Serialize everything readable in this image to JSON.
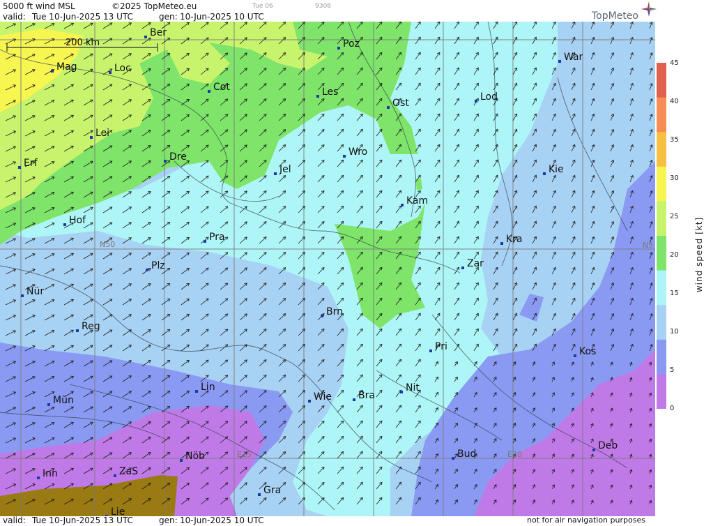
{
  "header": {
    "product": "5000 ft wind MSL",
    "copyright": "©2025 TopMeteo.eu",
    "valid_label": "valid:",
    "valid_value": "Tue  10-Jun-2025  13 UTC",
    "gen_label": "gen:",
    "gen_value": "10-Jun-2025 10 UTC",
    "day_code": "Tue 06",
    "run_code": "9308"
  },
  "footer": {
    "valid_label": "valid:",
    "valid_value": "Tue  10-Jun-2025  13 UTC",
    "gen_label": "gen:",
    "gen_value": "10-Jun-2025 10 UTC",
    "disclaimer": "not for air navigation purposes"
  },
  "logo": {
    "text": "TopMeteo"
  },
  "scale_bar": {
    "label": "200 km"
  },
  "grid_labels": {
    "n50": "N50",
    "e15": "E15",
    "e20": "E20",
    "n5_right": "N5"
  },
  "cities": [
    {
      "name": "Ber"
    },
    {
      "name": "Poz"
    },
    {
      "name": "War"
    },
    {
      "name": "Mag"
    },
    {
      "name": "Loc"
    },
    {
      "name": "Cot"
    },
    {
      "name": "Les"
    },
    {
      "name": "Lod"
    },
    {
      "name": "Ost"
    },
    {
      "name": "Lei"
    },
    {
      "name": "Dre"
    },
    {
      "name": "Wro"
    },
    {
      "name": "Erf"
    },
    {
      "name": "Jel"
    },
    {
      "name": "Kie"
    },
    {
      "name": "Kam"
    },
    {
      "name": "Hof"
    },
    {
      "name": "Kra"
    },
    {
      "name": "Pra"
    },
    {
      "name": "Zar"
    },
    {
      "name": "Plz"
    },
    {
      "name": "Nür"
    },
    {
      "name": "Brn"
    },
    {
      "name": "Reg"
    },
    {
      "name": "Pri"
    },
    {
      "name": "Kos"
    },
    {
      "name": "Lin"
    },
    {
      "name": "Nit"
    },
    {
      "name": "Wie"
    },
    {
      "name": "Bra"
    },
    {
      "name": "Mün"
    },
    {
      "name": "Deb"
    },
    {
      "name": "Nöb"
    },
    {
      "name": "Bud"
    },
    {
      "name": "Inn"
    },
    {
      "name": "ZaS"
    },
    {
      "name": "Gra"
    },
    {
      "name": "Lie"
    }
  ],
  "legend": {
    "title": "wind speed [kt]",
    "ticks": [
      "45",
      "40",
      "35",
      "30",
      "25",
      "20",
      "15",
      "10",
      "5",
      "0"
    ],
    "colors": [
      "#e26050",
      "#f58d55",
      "#f8c043",
      "#f7f550",
      "#c8f46d",
      "#7fe46a",
      "#aef5f7",
      "#a8d2f4",
      "#8a9af3",
      "#c07ae8"
    ]
  },
  "palette": {
    "purple": "#c07ae8",
    "blue_dark": "#8a9af3",
    "blue_light": "#a8d2f4",
    "cyan": "#aef5f7",
    "green": "#7fe46a",
    "lime": "#c8f46d",
    "yellow": "#f7f550",
    "terrain": "#9a7a12"
  }
}
